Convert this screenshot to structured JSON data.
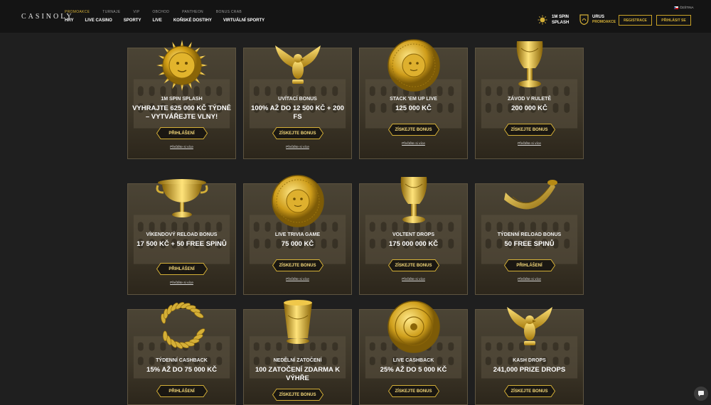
{
  "header": {
    "logo": "CASINOLY",
    "top_nav": [
      "PROMOAKCE",
      "TURNAJE",
      "VIP",
      "OBCHOD",
      "PANTHEON",
      "BONUS CRAB"
    ],
    "main_nav": [
      "HRY",
      "LIVE CASINO",
      "SPORTY",
      "LIVE",
      "KOŇSKÉ DOSTIHY",
      "VIRTUÁLNÍ SPORTY"
    ],
    "promo_spin": {
      "line1": "1M SPIN",
      "line2": "SPLASH"
    },
    "promo_urus": {
      "line1": "URUS",
      "line2": "PROMOAKCE"
    },
    "register_label": "REGISTRACE",
    "login_label": "PŘIHLÁSIT SE",
    "language": "ČEŠTINA"
  },
  "cards": [
    {
      "name": "1M SPIN SPLASH",
      "value": "VYHRAJTE 625 000 KČ TÝDNĚ – VYTVÁŘEJTE VLNY!",
      "button": "PŘIHLÁŠENÍ",
      "more": "Přečtěte si více",
      "icon": "sun-medallion-icon"
    },
    {
      "name": "UVÍTACÍ BONUS",
      "value": "100% AŽ DO 12 500 KČ + 200 FS",
      "button": "ZÍSKEJTE BONUS",
      "more": "Přečtěte si více",
      "icon": "eagle-icon"
    },
    {
      "name": "STACK 'EM UP LIVE",
      "value": "125 000 KČ",
      "button": "ZÍSKEJTE BONUS",
      "more": "Přečtěte si více",
      "icon": "medusa-shield-icon"
    },
    {
      "name": "ZÁVOD V RULETĚ",
      "value": "200 000 KČ",
      "button": "ZÍSKEJTE BONUS",
      "more": "Přečtěte si více",
      "icon": "goblet-icon"
    },
    {
      "name": "VÍKENDOVÝ RELOAD BONUS",
      "value": "17 500 KČ + 50 FREE SPINŮ",
      "button": "PŘIHLÁŠENÍ",
      "more": "Přečtěte si více",
      "icon": "kylix-cup-icon"
    },
    {
      "name": "LIVE TRIVIA GAME",
      "value": "75 000 KČ",
      "button": "ZÍSKEJTE BONUS",
      "more": "Přečtěte si více",
      "icon": "medusa-shield-icon"
    },
    {
      "name": "VOLTENT DROPS",
      "value": "175 000 000 KČ",
      "button": "ZÍSKEJTE BONUS",
      "more": "Přečtěte si více",
      "icon": "goblet-icon"
    },
    {
      "name": "TÝDENNÍ RELOAD BONUS",
      "value": "50 FREE SPINŮ",
      "button": "PŘIHLÁŠENÍ",
      "more": "Přečtěte si více",
      "icon": "rhyton-horn-icon"
    },
    {
      "name": "TÝDENNÍ CASHBACK",
      "value": "15% AŽ DO 75 000 KČ",
      "button": "PŘIHLÁŠENÍ",
      "more": "",
      "icon": "laurel-wreath-icon"
    },
    {
      "name": "NEDĚLNÍ ZATOČENÍ",
      "value": "100 ZATOČENÍ ZDARMA K VÝHŘE",
      "button": "ZÍSKEJTE BONUS",
      "more": "",
      "icon": "tall-cup-icon"
    },
    {
      "name": "LIVE CASHBACK",
      "value": "25% AŽ DO 5 000 KČ",
      "button": "ZÍSKEJTE BONUS",
      "more": "",
      "icon": "coin-icon"
    },
    {
      "name": "KASH DROPS",
      "value": "241,000 PRIZE DROPS",
      "button": "ZÍSKEJTE BONUS",
      "more": "",
      "icon": "eagle-icon"
    }
  ],
  "colors": {
    "gold": "#d4af37",
    "background": "#1f1f1f",
    "header": "#141414"
  }
}
